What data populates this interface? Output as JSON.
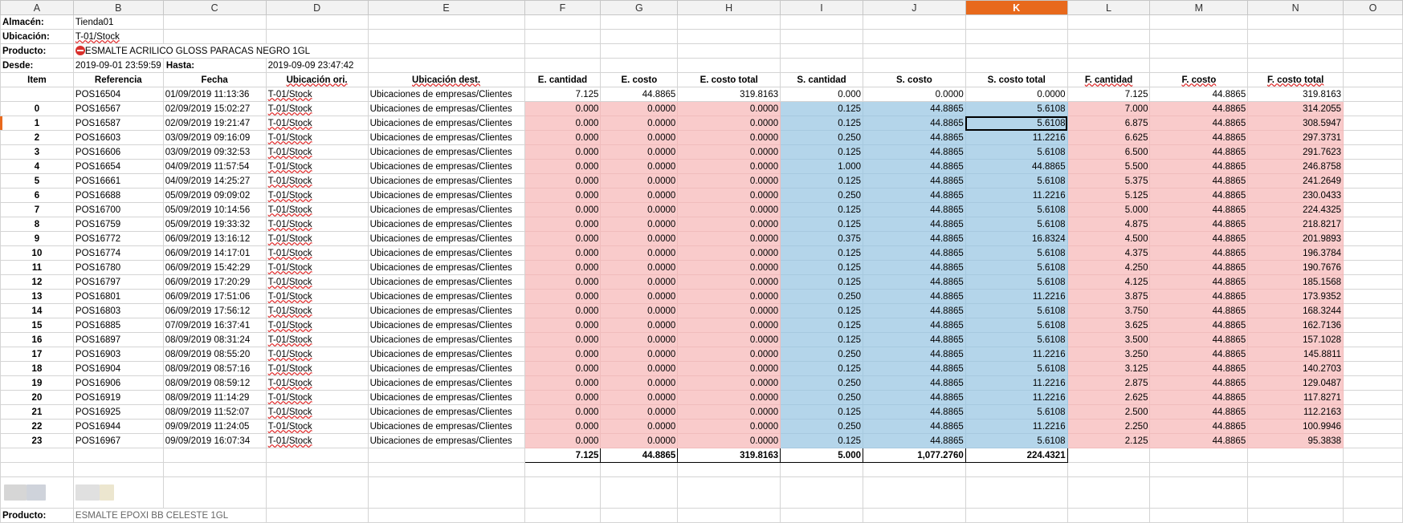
{
  "columns": [
    "A",
    "B",
    "C",
    "D",
    "E",
    "F",
    "G",
    "H",
    "I",
    "J",
    "K",
    "L",
    "M",
    "N",
    "O"
  ],
  "active_column": "K",
  "info": {
    "almacen_label": "Almacén:",
    "almacen_value": "Tienda01",
    "ubicacion_label": "Ubicación:",
    "ubicacion_value": "T-01/Stock",
    "producto_label": "Producto:",
    "producto_value": "ESMALTE ACRILICO GLOSS PARACAS NEGRO 1GL",
    "desde_label": "Desde:",
    "desde_value": "2019-09-01 23:59:59",
    "hasta_label": "Hasta:",
    "hasta_value": "2019-09-09 23:47:42"
  },
  "headers": [
    "Item",
    "Referencia",
    "Fecha",
    "Ubicación ori.",
    "Ubicación dest.",
    "E. cantidad",
    "E. costo",
    "E. costo total",
    "S. cantidad",
    "S. costo",
    "S. costo total",
    "F. cantidad",
    "F. costo",
    "F. costo total"
  ],
  "rows": [
    [
      "",
      "POS16504",
      "01/09/2019 11:13:36",
      "T-01/Stock",
      "Ubicaciones de empresas/Clientes",
      "7.125",
      "44.8865",
      "319.8163",
      "0.000",
      "0.0000",
      "0.0000",
      "7.125",
      "44.8865",
      "319.8163"
    ],
    [
      "0",
      "POS16567",
      "02/09/2019 15:02:27",
      "T-01/Stock",
      "Ubicaciones de empresas/Clientes",
      "0.000",
      "0.0000",
      "0.0000",
      "0.125",
      "44.8865",
      "5.6108",
      "7.000",
      "44.8865",
      "314.2055"
    ],
    [
      "1",
      "POS16587",
      "02/09/2019 19:21:47",
      "T-01/Stock",
      "Ubicaciones de empresas/Clientes",
      "0.000",
      "0.0000",
      "0.0000",
      "0.125",
      "44.8865",
      "5.6108",
      "6.875",
      "44.8865",
      "308.5947"
    ],
    [
      "2",
      "POS16603",
      "03/09/2019 09:16:09",
      "T-01/Stock",
      "Ubicaciones de empresas/Clientes",
      "0.000",
      "0.0000",
      "0.0000",
      "0.250",
      "44.8865",
      "11.2216",
      "6.625",
      "44.8865",
      "297.3731"
    ],
    [
      "3",
      "POS16606",
      "03/09/2019 09:32:53",
      "T-01/Stock",
      "Ubicaciones de empresas/Clientes",
      "0.000",
      "0.0000",
      "0.0000",
      "0.125",
      "44.8865",
      "5.6108",
      "6.500",
      "44.8865",
      "291.7623"
    ],
    [
      "4",
      "POS16654",
      "04/09/2019 11:57:54",
      "T-01/Stock",
      "Ubicaciones de empresas/Clientes",
      "0.000",
      "0.0000",
      "0.0000",
      "1.000",
      "44.8865",
      "44.8865",
      "5.500",
      "44.8865",
      "246.8758"
    ],
    [
      "5",
      "POS16661",
      "04/09/2019 14:25:27",
      "T-01/Stock",
      "Ubicaciones de empresas/Clientes",
      "0.000",
      "0.0000",
      "0.0000",
      "0.125",
      "44.8865",
      "5.6108",
      "5.375",
      "44.8865",
      "241.2649"
    ],
    [
      "6",
      "POS16688",
      "05/09/2019 09:09:02",
      "T-01/Stock",
      "Ubicaciones de empresas/Clientes",
      "0.000",
      "0.0000",
      "0.0000",
      "0.250",
      "44.8865",
      "11.2216",
      "5.125",
      "44.8865",
      "230.0433"
    ],
    [
      "7",
      "POS16700",
      "05/09/2019 10:14:56",
      "T-01/Stock",
      "Ubicaciones de empresas/Clientes",
      "0.000",
      "0.0000",
      "0.0000",
      "0.125",
      "44.8865",
      "5.6108",
      "5.000",
      "44.8865",
      "224.4325"
    ],
    [
      "8",
      "POS16759",
      "05/09/2019 19:33:32",
      "T-01/Stock",
      "Ubicaciones de empresas/Clientes",
      "0.000",
      "0.0000",
      "0.0000",
      "0.125",
      "44.8865",
      "5.6108",
      "4.875",
      "44.8865",
      "218.8217"
    ],
    [
      "9",
      "POS16772",
      "06/09/2019 13:16:12",
      "T-01/Stock",
      "Ubicaciones de empresas/Clientes",
      "0.000",
      "0.0000",
      "0.0000",
      "0.375",
      "44.8865",
      "16.8324",
      "4.500",
      "44.8865",
      "201.9893"
    ],
    [
      "10",
      "POS16774",
      "06/09/2019 14:17:01",
      "T-01/Stock",
      "Ubicaciones de empresas/Clientes",
      "0.000",
      "0.0000",
      "0.0000",
      "0.125",
      "44.8865",
      "5.6108",
      "4.375",
      "44.8865",
      "196.3784"
    ],
    [
      "11",
      "POS16780",
      "06/09/2019 15:42:29",
      "T-01/Stock",
      "Ubicaciones de empresas/Clientes",
      "0.000",
      "0.0000",
      "0.0000",
      "0.125",
      "44.8865",
      "5.6108",
      "4.250",
      "44.8865",
      "190.7676"
    ],
    [
      "12",
      "POS16797",
      "06/09/2019 17:20:29",
      "T-01/Stock",
      "Ubicaciones de empresas/Clientes",
      "0.000",
      "0.0000",
      "0.0000",
      "0.125",
      "44.8865",
      "5.6108",
      "4.125",
      "44.8865",
      "185.1568"
    ],
    [
      "13",
      "POS16801",
      "06/09/2019 17:51:06",
      "T-01/Stock",
      "Ubicaciones de empresas/Clientes",
      "0.000",
      "0.0000",
      "0.0000",
      "0.250",
      "44.8865",
      "11.2216",
      "3.875",
      "44.8865",
      "173.9352"
    ],
    [
      "14",
      "POS16803",
      "06/09/2019 17:56:12",
      "T-01/Stock",
      "Ubicaciones de empresas/Clientes",
      "0.000",
      "0.0000",
      "0.0000",
      "0.125",
      "44.8865",
      "5.6108",
      "3.750",
      "44.8865",
      "168.3244"
    ],
    [
      "15",
      "POS16885",
      "07/09/2019 16:37:41",
      "T-01/Stock",
      "Ubicaciones de empresas/Clientes",
      "0.000",
      "0.0000",
      "0.0000",
      "0.125",
      "44.8865",
      "5.6108",
      "3.625",
      "44.8865",
      "162.7136"
    ],
    [
      "16",
      "POS16897",
      "08/09/2019 08:31:24",
      "T-01/Stock",
      "Ubicaciones de empresas/Clientes",
      "0.000",
      "0.0000",
      "0.0000",
      "0.125",
      "44.8865",
      "5.6108",
      "3.500",
      "44.8865",
      "157.1028"
    ],
    [
      "17",
      "POS16903",
      "08/09/2019 08:55:20",
      "T-01/Stock",
      "Ubicaciones de empresas/Clientes",
      "0.000",
      "0.0000",
      "0.0000",
      "0.250",
      "44.8865",
      "11.2216",
      "3.250",
      "44.8865",
      "145.8811"
    ],
    [
      "18",
      "POS16904",
      "08/09/2019 08:57:16",
      "T-01/Stock",
      "Ubicaciones de empresas/Clientes",
      "0.000",
      "0.0000",
      "0.0000",
      "0.125",
      "44.8865",
      "5.6108",
      "3.125",
      "44.8865",
      "140.2703"
    ],
    [
      "19",
      "POS16906",
      "08/09/2019 08:59:12",
      "T-01/Stock",
      "Ubicaciones de empresas/Clientes",
      "0.000",
      "0.0000",
      "0.0000",
      "0.250",
      "44.8865",
      "11.2216",
      "2.875",
      "44.8865",
      "129.0487"
    ],
    [
      "20",
      "POS16919",
      "08/09/2019 11:14:29",
      "T-01/Stock",
      "Ubicaciones de empresas/Clientes",
      "0.000",
      "0.0000",
      "0.0000",
      "0.250",
      "44.8865",
      "11.2216",
      "2.625",
      "44.8865",
      "117.8271"
    ],
    [
      "21",
      "POS16925",
      "08/09/2019 11:52:07",
      "T-01/Stock",
      "Ubicaciones de empresas/Clientes",
      "0.000",
      "0.0000",
      "0.0000",
      "0.125",
      "44.8865",
      "5.6108",
      "2.500",
      "44.8865",
      "112.2163"
    ],
    [
      "22",
      "POS16944",
      "09/09/2019 11:24:05",
      "T-01/Stock",
      "Ubicaciones de empresas/Clientes",
      "0.000",
      "0.0000",
      "0.0000",
      "0.250",
      "44.8865",
      "11.2216",
      "2.250",
      "44.8865",
      "100.9946"
    ],
    [
      "23",
      "POS16967",
      "09/09/2019 16:07:34",
      "T-01/Stock",
      "Ubicaciones de empresas/Clientes",
      "0.000",
      "0.0000",
      "0.0000",
      "0.125",
      "44.8865",
      "5.6108",
      "2.125",
      "44.8865",
      "95.3838"
    ]
  ],
  "totals": [
    "7.125",
    "44.8865",
    "319.8163",
    "5.000",
    "1,077.2760",
    "224.4321"
  ],
  "partial_label": "Producto:",
  "partial_value": "ESMALTE EPOXI BB CELESTE 1GL",
  "colors": {
    "entrada": "#f9cbcb",
    "salida": "#b4d5ea",
    "active_header": "#e8691c"
  }
}
